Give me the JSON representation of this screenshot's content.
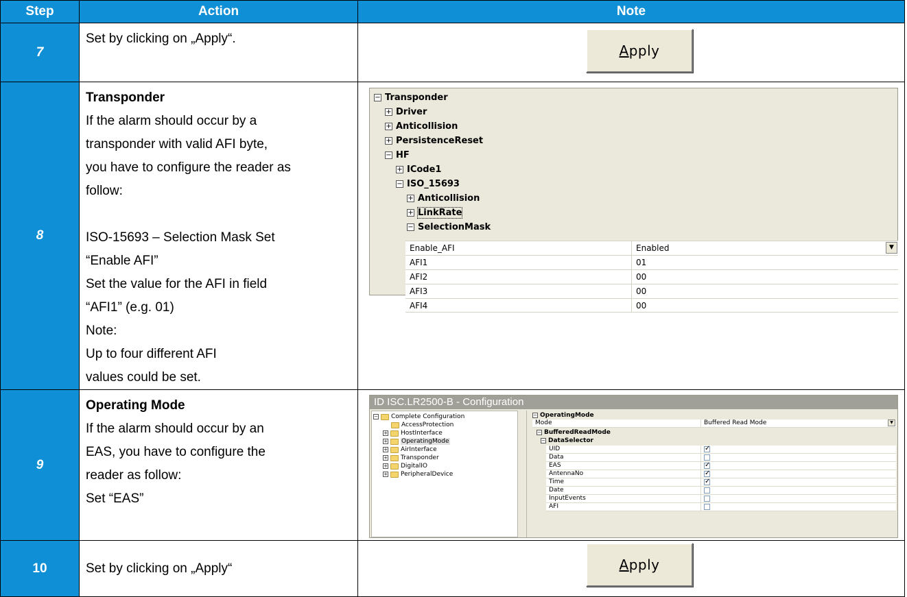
{
  "header": {
    "step": "Step",
    "action": "Action",
    "note": "Note"
  },
  "rows": {
    "r7": {
      "step": "7",
      "action": "Set by clicking on „Apply“.",
      "button": {
        "pre": "",
        "under": "A",
        "post": "pply"
      }
    },
    "r8": {
      "step": "8",
      "action": {
        "title": "Transponder",
        "lines": [
          "If the alarm should occur by a",
          "transponder with valid AFI byte,",
          "you have to configure the reader as",
          "follow:",
          "ISO-15693 – Selection Mask Set",
          "“Enable AFI”",
          "Set the value for the AFI in field",
          "“AFI1” (e.g. 01)",
          "Note:",
          "Up to four different AFI",
          "values could be set."
        ]
      },
      "tree": {
        "nodes": [
          "Transponder",
          "Driver",
          "Anticollision",
          "PersistenceReset",
          "HF",
          "ICode1",
          "ISO_15693",
          "Anticollision",
          "LinkRate",
          "SelectionMask"
        ],
        "grid": [
          {
            "key": "Enable_AFI",
            "value": "Enabled"
          },
          {
            "key": "AFI1",
            "value": "01"
          },
          {
            "key": "AFI2",
            "value": "00"
          },
          {
            "key": "AFI3",
            "value": "00"
          },
          {
            "key": "AFI4",
            "value": "00"
          }
        ]
      }
    },
    "r9": {
      "step": "9",
      "action": {
        "title": "Operating Mode",
        "lines": [
          "If the alarm should occur by an",
          "EAS, you have to configure the",
          "reader as follow:",
          "Set “EAS”"
        ]
      },
      "config": {
        "title": "ID ISC.LR2500-B - Configuration",
        "left_tree": [
          "Complete Configuration",
          "AccessProtection",
          "HostInterface",
          "OperatingMode",
          "AirInterface",
          "Transponder",
          "DigitalIO",
          "PeripheralDevice"
        ],
        "right": {
          "root": "OperatingMode",
          "mode_key": "Mode",
          "mode_value": "Buffered Read Mode",
          "sub": "BufferedReadMode",
          "subsub": "DataSelector",
          "items": [
            {
              "key": "UID",
              "checked": true
            },
            {
              "key": "Data",
              "checked": false
            },
            {
              "key": "EAS",
              "checked": true
            },
            {
              "key": "AntennaNo",
              "checked": true
            },
            {
              "key": "Time",
              "checked": true
            },
            {
              "key": "Date",
              "checked": false
            },
            {
              "key": "InputEvents",
              "checked": false
            },
            {
              "key": "AFI",
              "checked": false
            }
          ]
        }
      }
    },
    "r10": {
      "step": "10",
      "action": "Set by clicking on „Apply“",
      "button": {
        "pre": "",
        "under": "A",
        "post": "pply"
      }
    }
  },
  "colors": {
    "header_blue": "#0f8fd6",
    "window_bg": "#ebe9dc"
  },
  "icons": {
    "expand": "plus-box-icon",
    "collapse": "minus-box-icon",
    "folder": "folder-icon",
    "dropdown": "dropdown-arrow-icon",
    "checkbox": "checkbox-icon"
  }
}
